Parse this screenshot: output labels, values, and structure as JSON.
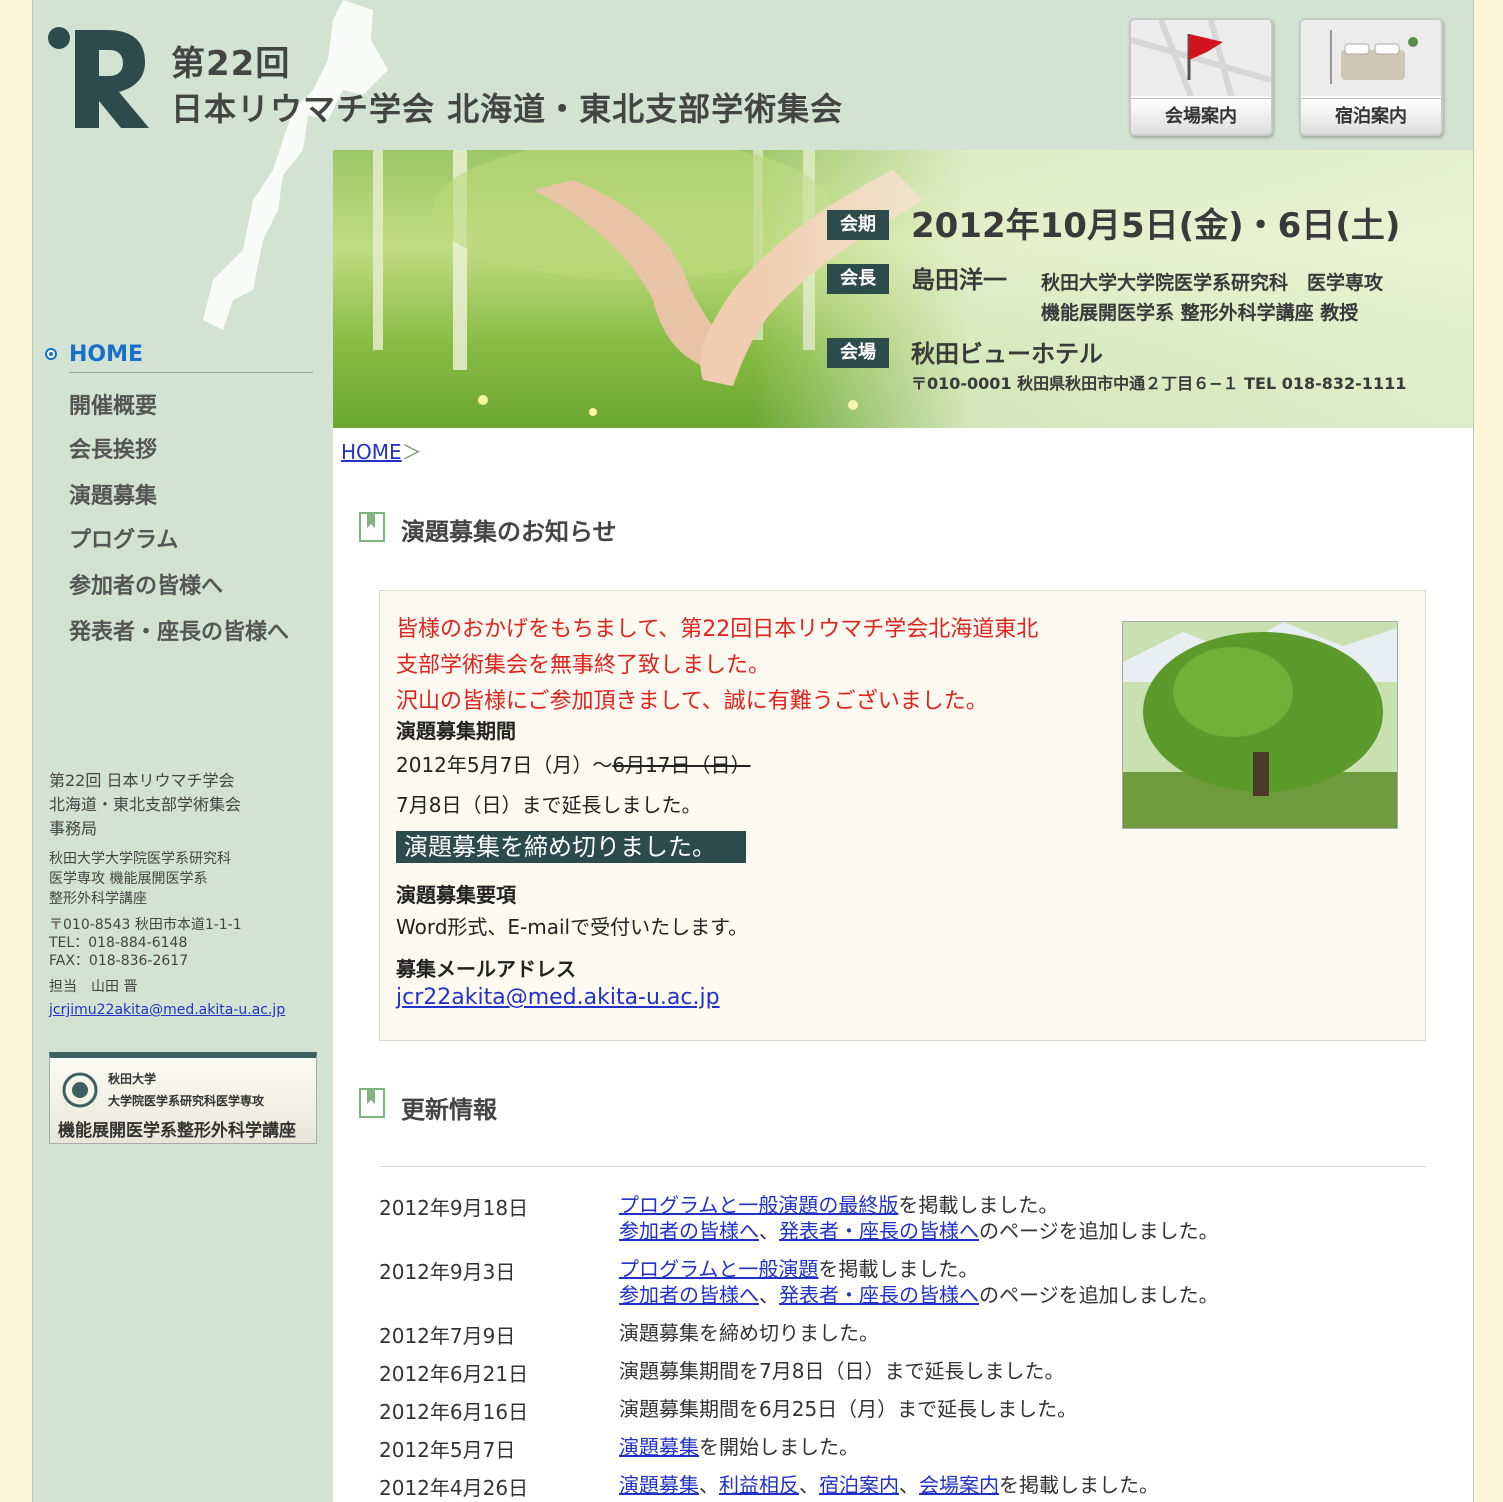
{
  "header": {
    "title_line1": "第22回",
    "title_line2": "日本リウマチ学会 北海道・東北支部学術集会",
    "nav_venue": "会場案内",
    "nav_hotel": "宿泊案内"
  },
  "hero": {
    "tag_period": "会期",
    "period": "2012年10月5日(金)・6日(土)",
    "tag_chair": "会長",
    "chair_name": "島田洋一",
    "chair_aff1": "秋田大学大学院医学系研究科　医学専攻",
    "chair_aff2": "機能展開医学系 整形外科学講座 教授",
    "tag_venue": "会場",
    "venue_name": "秋田ビューホテル",
    "venue_addr": "〒010-0001 秋田県秋田市中通２丁目６−１ TEL 018-832-1111"
  },
  "sidebar": {
    "home": "HOME",
    "items": [
      "開催概要",
      "会長挨拶",
      "演題募集",
      "プログラム",
      "参加者の皆様へ",
      "発表者・座長の皆様へ"
    ],
    "office_l1": "第22回 日本リウマチ学会",
    "office_l2": "北海道・東北支部学術集会",
    "office_l3": "事務局",
    "dept_l1": "秋田大学大学院医学系研究科",
    "dept_l2": "医学専攻 機能展開医学系",
    "dept_l3": "整形外科学講座",
    "addr": "〒010-8543 秋田市本道1-1-1",
    "tel": "TEL：018-884-6148",
    "fax": "FAX：018-836-2617",
    "contact": "担当　山田 晋",
    "email": "jcrjimu22akita@med.akita-u.ac.jp",
    "banner_l1": "秋田大学",
    "banner_l2": "大学院医学系研究科医学専攻",
    "banner_l3": "機能展開医学系整形外科学講座"
  },
  "breadcrumb": {
    "home": "HOME",
    "sep": "＞"
  },
  "notice": {
    "heading": "演題募集のお知らせ",
    "red_l1": "皆様のおかげをもちまして、第22回日本リウマチ学会北海道東北",
    "red_l2": "支部学術集会を無事終了致しました。",
    "red_l3": "沢山の皆様にご参加頂きまして、誠に有難うございました。",
    "period_label": "演題募集期間",
    "period_start": "2012年5月7日（月）〜",
    "period_struck": "6月17日（日）",
    "extended": "7月8日（日）まで延長しました。",
    "closed": "演題募集を締め切りました。",
    "req_label": "演題募集要項",
    "req_text": "Word形式、E-mailで受付いたします。",
    "mail_label": "募集メールアドレス",
    "mail": "jcr22akita@med.akita-u.ac.jp"
  },
  "updates": {
    "heading": "更新情報",
    "rows": [
      {
        "date": "2012年9月18日",
        "l1a": "プログラムと一般演題の最終版",
        "l1b": "を掲載しました。",
        "l2a": "参加者の皆様へ",
        "l2s": "、",
        "l2b": "発表者・座長の皆様へ",
        "l2c": "のページを追加しました。"
      },
      {
        "date": "2012年9月3日",
        "l1a": "プログラムと一般演題",
        "l1b": "を掲載しました。",
        "l2a": "参加者の皆様へ",
        "l2s": "、",
        "l2b": "発表者・座長の皆様へ",
        "l2c": "のページを追加しました。"
      },
      {
        "date": "2012年7月9日",
        "text": "演題募集を締め切りました。"
      },
      {
        "date": "2012年6月21日",
        "text": "演題募集期間を7月8日（日）まで延長しました。"
      },
      {
        "date": "2012年6月16日",
        "text": "演題募集期間を6月25日（月）まで延長しました。"
      },
      {
        "date": "2012年5月7日",
        "la": "演題募集",
        "lb": "を開始しました。"
      },
      {
        "date": "2012年4月26日",
        "links": [
          "演題募集",
          "利益相反",
          "宿泊案内",
          "会場案内"
        ],
        "sep": "、",
        "tail": "を掲載しました。"
      }
    ]
  }
}
